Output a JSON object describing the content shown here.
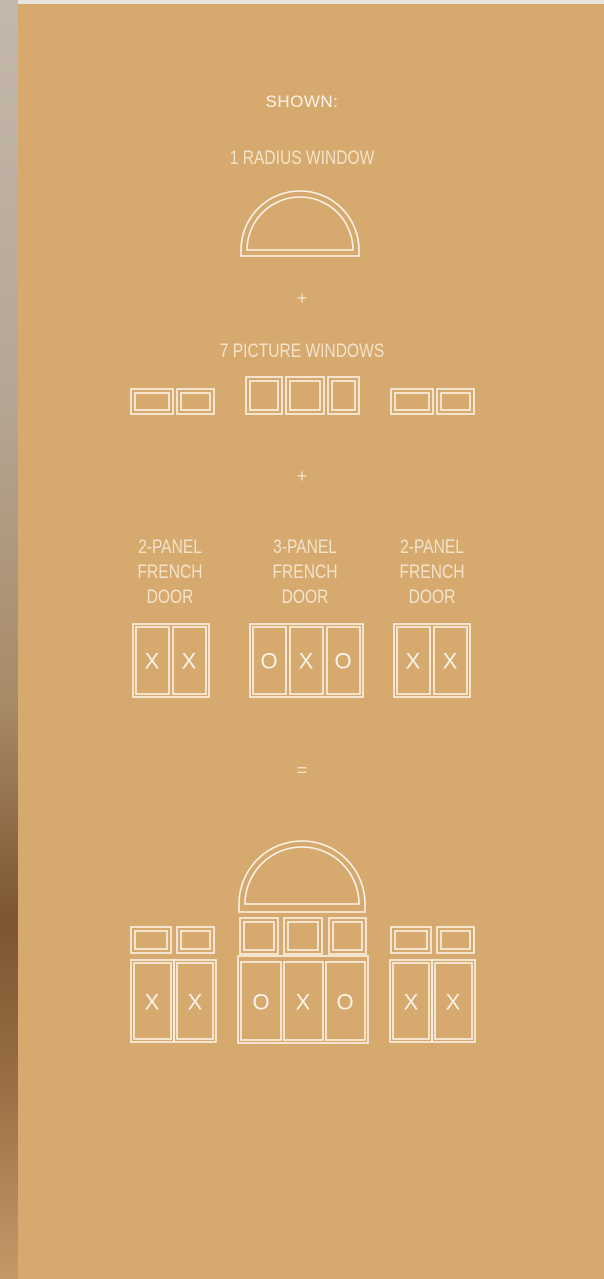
{
  "header": {
    "shown_label": "SHOWN:"
  },
  "radius": {
    "caption": "1 RADIUS WINDOW"
  },
  "operators": {
    "plus_1": "+",
    "plus_2": "+",
    "equals": "="
  },
  "picture": {
    "caption": "7 PICTURE WINDOWS"
  },
  "doors": [
    {
      "lines": [
        "2-PANEL",
        "FRENCH",
        "DOOR"
      ],
      "panels": [
        "X",
        "X"
      ]
    },
    {
      "lines": [
        "3-PANEL",
        "FRENCH",
        "DOOR"
      ],
      "panels": [
        "O",
        "X",
        "O"
      ]
    },
    {
      "lines": [
        "2-PANEL",
        "FRENCH",
        "DOOR"
      ],
      "panels": [
        "X",
        "X"
      ]
    }
  ],
  "colors": {
    "background": "#d6a96f",
    "line": "#fbf3e7"
  }
}
